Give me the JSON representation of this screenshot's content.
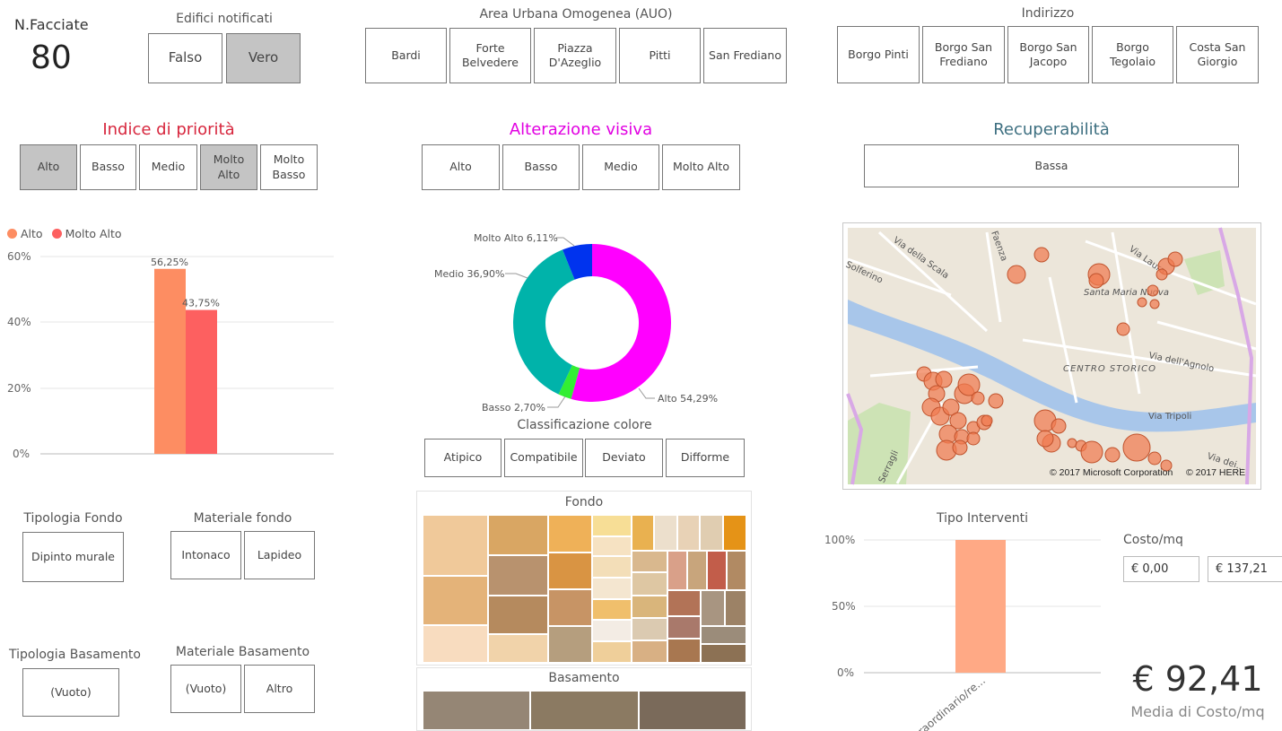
{
  "facciate": {
    "label": "N.Facciate",
    "value": "80"
  },
  "edifici": {
    "title": "Edifici notificati",
    "options": [
      "Falso",
      "Vero"
    ]
  },
  "auo": {
    "title": "Area Urbana Omogenea (AUO)",
    "options": [
      "Bardi",
      "Forte Belvedere",
      "Piazza D'Azeglio",
      "Pitti",
      "San Frediano"
    ]
  },
  "indirizzo": {
    "title": "Indirizzo",
    "options": [
      "Borgo Pinti",
      "Borgo San Frediano",
      "Borgo San Jacopo",
      "Borgo Tegolaio",
      "Costa San Giorgio"
    ]
  },
  "priorita": {
    "title": "Indice di priorità",
    "title_color": "#d7263d",
    "options": [
      "Alto",
      "Basso",
      "Medio",
      "Molto Alto",
      "Molto Basso"
    ],
    "selected": [
      "Alto",
      "Molto Alto"
    ]
  },
  "alterazione": {
    "title": "Alterazione visiva",
    "title_color": "#e100e1",
    "options": [
      "Alto",
      "Basso",
      "Medio",
      "Molto Alto"
    ]
  },
  "recuperabilita": {
    "title": "Recuperabilità",
    "title_color": "#3d6f80",
    "options": [
      "Bassa"
    ]
  },
  "classificazione": {
    "title": "Classificazione colore",
    "options": [
      "Atipico",
      "Compatibile",
      "Deviato",
      "Difforme"
    ]
  },
  "fondo_treemap": {
    "title": "Fondo"
  },
  "basamento_treemap": {
    "title": "Basamento"
  },
  "tipologia_fondo": {
    "title": "Tipologia Fondo",
    "options": [
      "Dipinto murale"
    ]
  },
  "materiale_fondo": {
    "title": "Materiale fondo",
    "options": [
      "Intonaco",
      "Lapideo"
    ]
  },
  "tipologia_basamento": {
    "title": "Tipologia Basamento",
    "options": [
      "(Vuoto)"
    ]
  },
  "materiale_basamento": {
    "title": "Materiale Basamento",
    "options": [
      "(Vuoto)",
      "Altro"
    ]
  },
  "tipo_interventi": {
    "title": "Tipo Interventi"
  },
  "costo": {
    "title": "Costo/mq",
    "min": "€ 0,00",
    "max": "€ 137,21"
  },
  "media": {
    "value": "€ 92,41",
    "label": "Media di Costo/mq"
  },
  "map": {
    "labels": [
      "Via della Scala",
      "Faenza",
      "Solferino",
      "Via Laura",
      "Santa Maria Nuova",
      "CENTRO STORICO",
      "Via dell'Agnolo",
      "Via Tripoli",
      "Serragli",
      "Via dei..."
    ],
    "copyright1": "© 2017 Microsoft Corporation",
    "copyright2": "© 2017 HERE"
  },
  "chart_data": [
    {
      "type": "bar",
      "title": "",
      "categories": [
        ""
      ],
      "series": [
        {
          "name": "Alto",
          "values": [
            56.25
          ],
          "color": "#fd8d62"
        },
        {
          "name": "Molto Alto",
          "values": [
            43.75
          ],
          "color": "#fd6060"
        }
      ],
      "data_labels": [
        "56,25%",
        "43,75%"
      ],
      "ylim": [
        0,
        60
      ],
      "yticks": [
        "0%",
        "20%",
        "40%",
        "60%"
      ],
      "legend": "top-left",
      "grid": true
    },
    {
      "type": "pie",
      "subtype": "donut",
      "title": "",
      "slices": [
        {
          "name": "Alto",
          "value": 54.29,
          "label": "Alto 54,29%",
          "color": "#ff00ff"
        },
        {
          "name": "Basso",
          "value": 2.7,
          "label": "Basso 2,70%",
          "color": "#33ee33"
        },
        {
          "name": "Medio",
          "value": 36.9,
          "label": "Medio 36,90%",
          "color": "#00b3aa"
        },
        {
          "name": "Molto Alto",
          "value": 6.11,
          "label": "Molto Alto 6,11%",
          "color": "#0033ee"
        }
      ]
    },
    {
      "type": "bar",
      "title": "Tipo Interventi",
      "categories": [
        "Straordinario/re..."
      ],
      "values": [
        100
      ],
      "color": "#ffa985",
      "ylim": [
        0,
        100
      ],
      "yticks": [
        "0%",
        "50%",
        "100%"
      ],
      "grid": true
    }
  ]
}
